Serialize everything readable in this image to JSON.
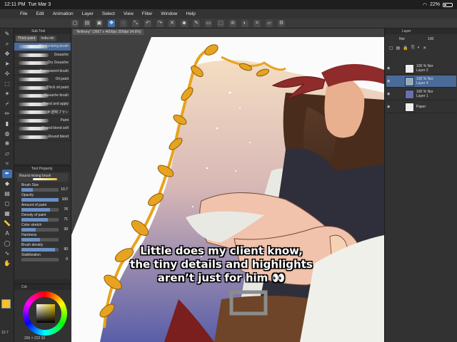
{
  "status": {
    "time": "12:11 PM",
    "date": "Tue Mar 3",
    "battery": "22%"
  },
  "menu": [
    "File",
    "Edit",
    "Animation",
    "Layer",
    "Select",
    "View",
    "Filter",
    "Window",
    "Help"
  ],
  "document_tab": "\"Anthony\" (3667 x 4600px 300dpi 34.6%)",
  "subtool": {
    "title": "Sub Tool",
    "tabs": [
      "Thick paint",
      "India ink"
    ],
    "brushes": [
      "Thick mixing brush",
      "Gouache",
      "Dry Gouache",
      "Transparent brush",
      "Oil paint",
      "Thick oil paint",
      "Gouache brush",
      "Blend and apply",
      "半透明ブラシ",
      "Paint",
      "Round blend soft",
      "Round blend"
    ]
  },
  "tool_property": {
    "title": "Tool Property",
    "current": "Round mixing brush",
    "props": [
      {
        "label": "Brush Size",
        "value": "10.7",
        "fill": 0.3
      },
      {
        "label": "Opacity",
        "value": "100",
        "fill": 1.0
      },
      {
        "label": "Amount of paint",
        "value": "76",
        "fill": 0.76
      },
      {
        "label": "Density of paint",
        "value": "71",
        "fill": 0.71
      },
      {
        "label": "Color stretch",
        "value": "39",
        "fill": 0.39
      },
      {
        "label": "Hardness",
        "value": "",
        "fill": 0.5
      },
      {
        "label": "Brush density",
        "value": "90",
        "fill": 0.9
      },
      {
        "label": "Stabilization",
        "value": "0",
        "fill": 0.0
      }
    ]
  },
  "color": {
    "panel_title": "Col",
    "rgb": "255 × 222 92",
    "size_value": "12.7",
    "main_color": "#f1c232"
  },
  "layers": {
    "title": "Layer",
    "mode": "Nor",
    "opacity": "100",
    "items": [
      {
        "name": "Layer 2",
        "info": "100 % Nor"
      },
      {
        "name": "Layer 4",
        "info": "100 % Nor"
      },
      {
        "name": "Layer 1",
        "info": "100 % Nor"
      },
      {
        "name": "Paper",
        "info": ""
      }
    ]
  },
  "caption": {
    "line1": "Little does my client know,",
    "line2": "the tiny details and highlights",
    "line3": "aren’t just for him 👀"
  },
  "colors": {
    "accent": "#3f6fae",
    "leaf": "#e8a31e",
    "bandana": "#8f2b2b",
    "sky_top": "#f3dcc0",
    "sky_bottom": "#5a5ea8"
  }
}
